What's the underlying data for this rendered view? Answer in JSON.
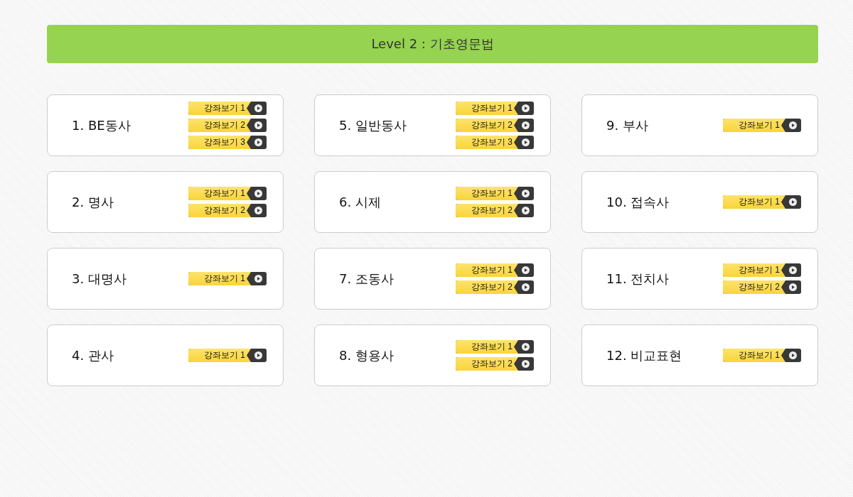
{
  "header": {
    "title": "Level 2 : 기초영문법"
  },
  "lessons": [
    {
      "title": "1. BE동사",
      "buttons": [
        "강좌보기 1",
        "강좌보기 2",
        "강좌보기 3"
      ]
    },
    {
      "title": "2. 명사",
      "buttons": [
        "강좌보기 1",
        "강좌보기 2"
      ]
    },
    {
      "title": "3. 대명사",
      "buttons": [
        "강좌보기 1"
      ]
    },
    {
      "title": "4. 관사",
      "buttons": [
        "강좌보기 1"
      ]
    },
    {
      "title": "5. 일반동사",
      "buttons": [
        "강좌보기 1",
        "강좌보기 2",
        "강좌보기 3"
      ]
    },
    {
      "title": "6. 시제",
      "buttons": [
        "강좌보기 1",
        "강좌보기 2"
      ]
    },
    {
      "title": "7. 조동사",
      "buttons": [
        "강좌보기 1",
        "강좌보기 2"
      ]
    },
    {
      "title": "8. 형용사",
      "buttons": [
        "강좌보기 1",
        "강좌보기 2"
      ]
    },
    {
      "title": "9. 부사",
      "buttons": [
        "강좌보기 1"
      ]
    },
    {
      "title": "10. 접속사",
      "buttons": [
        "강좌보기 1"
      ]
    },
    {
      "title": "11. 전치사",
      "buttons": [
        "강좌보기 1",
        "강좌보기 2"
      ]
    },
    {
      "title": "12. 비교표현",
      "buttons": [
        "강좌보기 1"
      ]
    }
  ]
}
